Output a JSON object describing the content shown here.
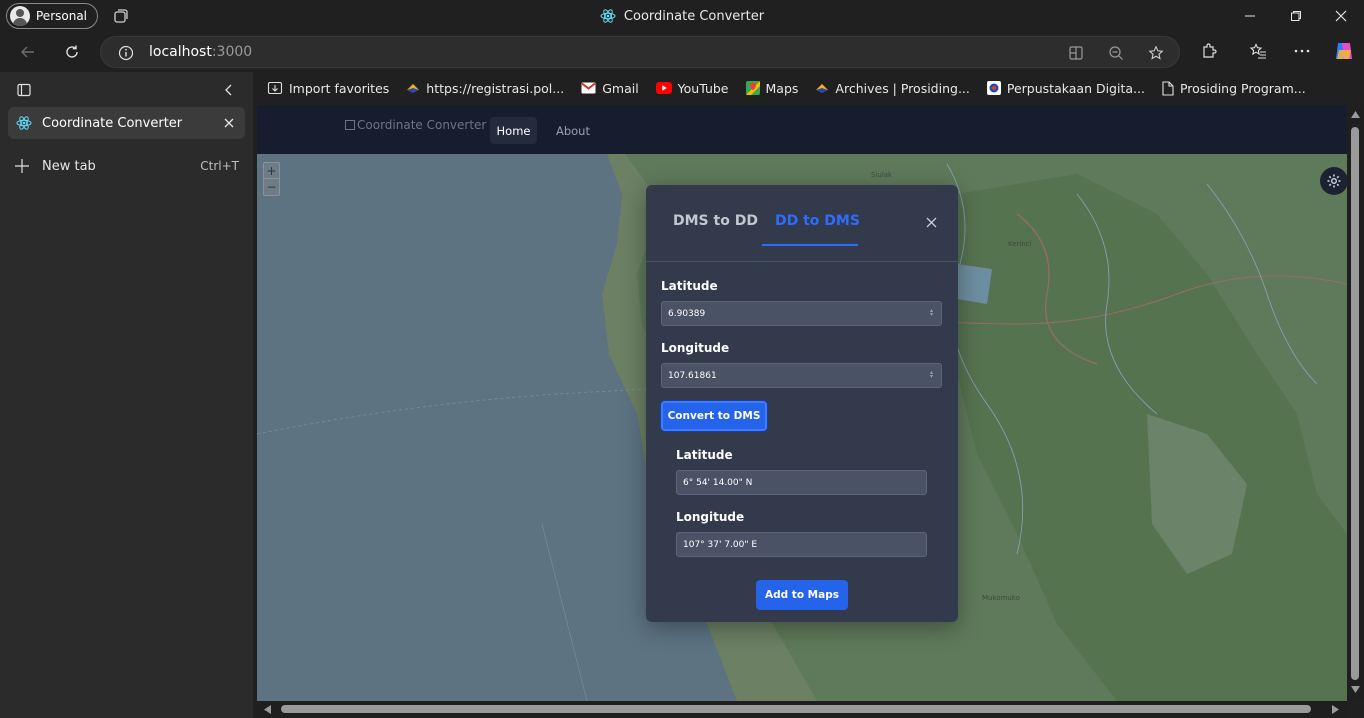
{
  "window": {
    "profile_label": "Personal",
    "title": "Coordinate Converter",
    "title_icon": "react-icon",
    "controls": [
      "minimize-icon",
      "restore-icon",
      "close-icon"
    ]
  },
  "address_bar": {
    "host": "localhost",
    "port": ":3000"
  },
  "sidebar": {
    "tab_title": "Coordinate Converter",
    "new_tab_label": "New tab",
    "new_tab_shortcut": "Ctrl+T"
  },
  "bookmarks": [
    {
      "label": "Import favorites",
      "icon": "import-icon"
    },
    {
      "label": "https://registrasi.pol...",
      "icon": "site-icon"
    },
    {
      "label": "Gmail",
      "icon": "gmail-icon"
    },
    {
      "label": "YouTube",
      "icon": "youtube-icon"
    },
    {
      "label": "Maps",
      "icon": "maps-icon"
    },
    {
      "label": "Archives | Prosiding...",
      "icon": "site-icon"
    },
    {
      "label": "Perpustakaan Digita...",
      "icon": "library-icon"
    },
    {
      "label": "Prosiding Program...",
      "icon": "page-icon"
    }
  ],
  "app": {
    "brand_alt": "Coordinate Converter",
    "nav": {
      "home": "Home",
      "about": "About"
    },
    "map": {
      "zoom_in": "+",
      "zoom_out": "−",
      "place_labels": [
        "Siulak",
        "Kerinci",
        "Mukomuko"
      ]
    },
    "modal": {
      "tabs": {
        "dms_to_dd": "DMS to DD",
        "dd_to_dms": "DD to DMS"
      },
      "active_tab": "DD to DMS",
      "latitude_label": "Latitude",
      "latitude_value": "6.90389",
      "longitude_label": "Longitude",
      "longitude_value": "107.61861",
      "convert_button": "Convert to DMS",
      "result": {
        "latitude_label": "Latitude",
        "latitude_value": "6° 54' 14.00\" N",
        "longitude_label": "Longitude",
        "longitude_value": "107° 37' 7.00\" E"
      },
      "add_button": "Add to Maps"
    }
  },
  "colors": {
    "accent": "#2563eb",
    "modal_bg": "#323a4b",
    "app_nav_bg": "#161d2e",
    "chrome_bg": "#202020"
  }
}
